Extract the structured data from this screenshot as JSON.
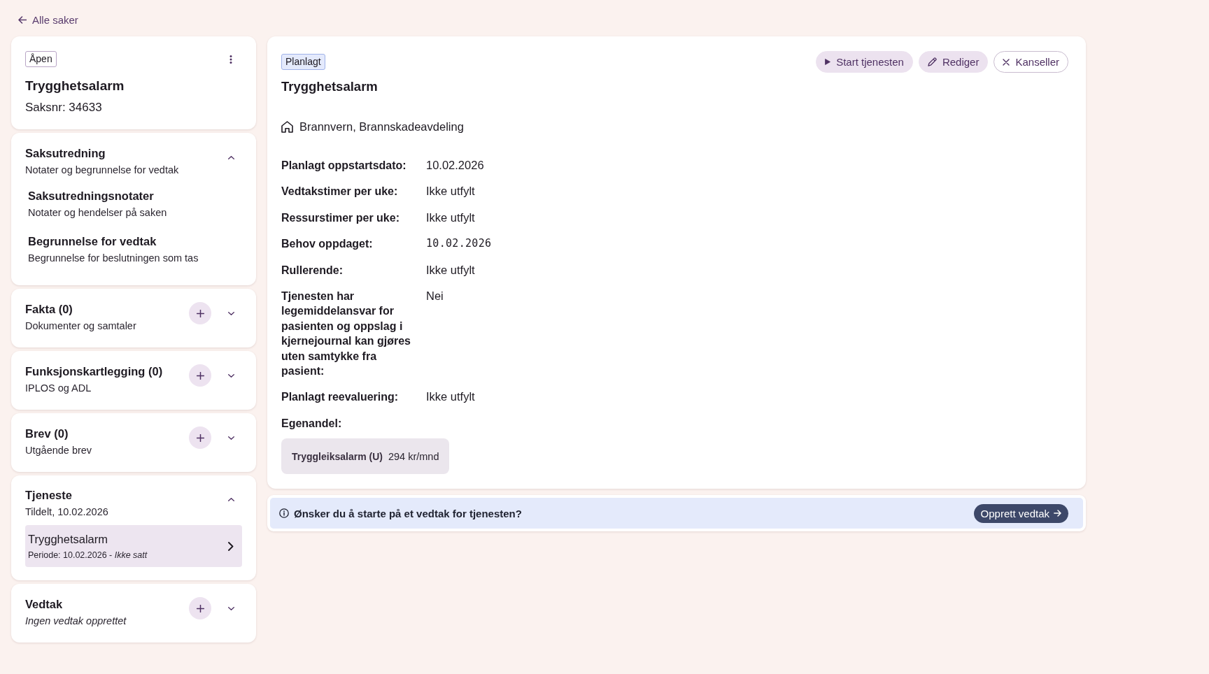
{
  "back_link": {
    "label": "Alle saker"
  },
  "case": {
    "status": "Åpen",
    "title": "Trygghetsalarm",
    "case_number": "Saksnr: 34633"
  },
  "sections": [
    {
      "kind": "notes",
      "title": "Saksutredning",
      "subtitle": "Notater og begrunnelse for vedtak",
      "subtitle_italic": false,
      "expanded": true,
      "items": [
        {
          "title": "Saksutredningsnotater",
          "subtitle": "Notater og hendelser på saken"
        },
        {
          "title": "Begrunnelse for vedtak",
          "subtitle": "Begrunnelse for beslutningen som tas"
        }
      ]
    },
    {
      "kind": "addable",
      "title": "Fakta (0)",
      "subtitle": "Dokumenter og samtaler",
      "subtitle_italic": false,
      "expanded": false
    },
    {
      "kind": "addable",
      "title": "Funksjonskartlegging (0)",
      "subtitle": "IPLOS og ADL",
      "subtitle_italic": false,
      "expanded": false
    },
    {
      "kind": "addable",
      "title": "Brev (0)",
      "subtitle": "Utgående brev",
      "subtitle_italic": false,
      "expanded": false
    },
    {
      "kind": "services",
      "title": "Tjeneste",
      "subtitle": "Tildelt, 10.02.2026",
      "subtitle_italic": false,
      "expanded": true,
      "items": [
        {
          "title": "Trygghetsalarm",
          "subtitle": "Periode: 10.02.2026 - *Ikke satt*"
        }
      ]
    },
    {
      "kind": "addable",
      "title": "Vedtak",
      "subtitle": "Ingen vedtak opprettet",
      "subtitle_italic": true,
      "expanded": false
    }
  ],
  "service": {
    "status": "Planlagt",
    "title": "Trygghetsalarm",
    "actions": [
      {
        "kind": "start",
        "label": "Start tjenesten"
      },
      {
        "kind": "edit",
        "label": "Rediger"
      },
      {
        "kind": "cancel",
        "label": "Kanseller"
      }
    ],
    "location": "Brannvern, Brannskadeavdeling",
    "fields": [
      {
        "kind": "text",
        "label": "Planlagt oppstartsdato:",
        "value": "10.02.2026"
      },
      {
        "kind": "text",
        "label": "Vedtakstimer per uke:",
        "value": "Ikke utfylt"
      },
      {
        "kind": "text",
        "label": "Ressurstimer per uke:",
        "value": "Ikke utfylt"
      },
      {
        "kind": "mono",
        "label": "Behov oppdaget:",
        "value": "10.02.2026"
      },
      {
        "kind": "text",
        "label": "Rullerende:",
        "value": "Ikke utfylt"
      },
      {
        "kind": "text",
        "label": "Tjenesten har legemiddelansvar for pasienten og oppslag i kjernejournal kan gjøres uten samtykke fra pasient:",
        "value": "Nei"
      },
      {
        "kind": "text",
        "label": "Planlagt reevaluering:",
        "value": "Ikke utfylt"
      }
    ],
    "egenandel": {
      "label": "Egenandel:",
      "items": [
        {
          "name": "Tryggleiksalarm (U)",
          "price": "294 kr/mnd"
        }
      ]
    }
  },
  "banner": {
    "message": "Ønsker du å starte på et vedtak for tjenesten?",
    "button": "Opprett vedtak"
  }
}
